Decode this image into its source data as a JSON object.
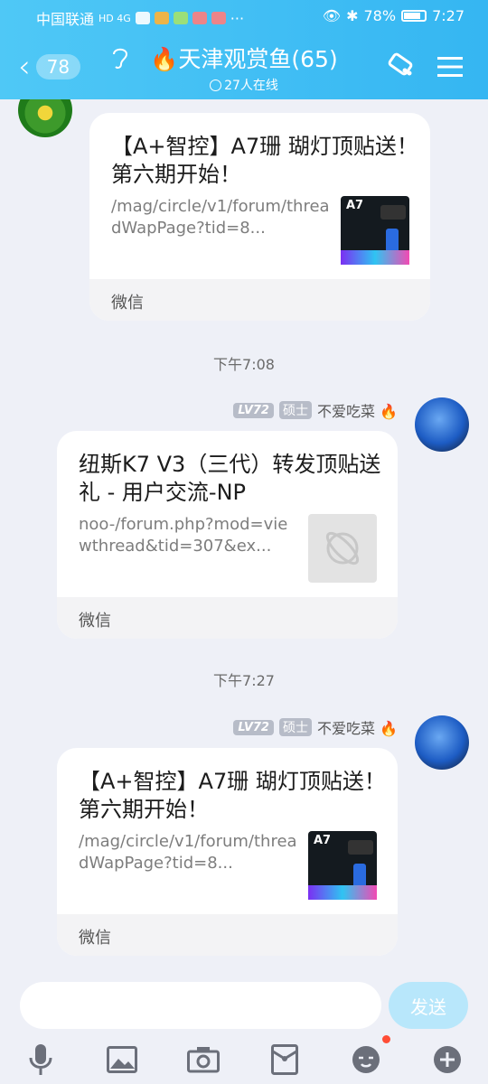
{
  "status_bar": {
    "carrier": "中国联通",
    "network": "HD 4G",
    "battery": "78%",
    "time": "7:27"
  },
  "header": {
    "back_count": "78",
    "title": "🔥天津观赏鱼(65)",
    "online": "27人在线"
  },
  "messages": [
    {
      "title": "【A+智控】A7珊 瑚灯顶贴送！ 第六期开始！",
      "url": "/mag/circle/v1/forum/threadWapPage?tid=8...",
      "thumb_label": "A7",
      "source": "微信"
    },
    {
      "time": "下午7:08",
      "level": "LV72",
      "degree": "硕士",
      "sender": "不爱吃菜 🔥",
      "title": "纽斯K7 V3（三代）转发顶贴送礼 - 用户交流-NP",
      "url": "noo-/forum.php?mod=viewthread&tid=307&ex...",
      "source": "微信"
    },
    {
      "time": "下午7:27",
      "level": "LV72",
      "degree": "硕士",
      "sender": "不爱吃菜 🔥",
      "title": "【A+智控】A7珊 瑚灯顶贴送！ 第六期开始！",
      "url": "/mag/circle/v1/forum/threadWapPage?tid=8...",
      "thumb_label": "A7",
      "source": "微信"
    }
  ],
  "composer": {
    "send_label": "发送"
  },
  "colors": {
    "header": "#3fbff4",
    "send_disabled": "#b8e7fb",
    "background": "#eef0f7"
  }
}
